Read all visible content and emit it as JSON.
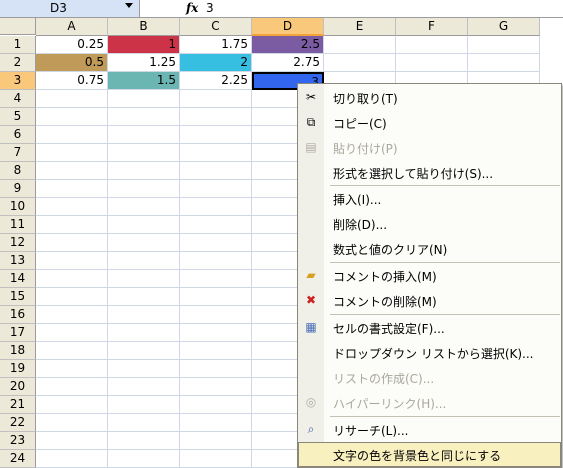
{
  "formula_bar": {
    "name_box": "D3",
    "fx_icon": "fx",
    "formula": "3"
  },
  "columns": [
    "A",
    "B",
    "C",
    "D",
    "E",
    "F",
    "G"
  ],
  "rows": [
    "1",
    "2",
    "3",
    "4",
    "5",
    "6",
    "7",
    "8",
    "9",
    "10",
    "11",
    "12",
    "13",
    "14",
    "15",
    "16",
    "17",
    "18",
    "19",
    "20",
    "21",
    "22",
    "23",
    "24"
  ],
  "cells": {
    "A1": "0.25",
    "B1": "1",
    "C1": "1.75",
    "D1": "2.5",
    "A2": "0.5",
    "B2": "1.25",
    "C2": "2",
    "D2": "2.75",
    "A3": "0.75",
    "B3": "1.5",
    "C3": "2.25",
    "D3": "3"
  },
  "cell_colors": {
    "B1": "#cc3346",
    "D1": "#7b5ca3",
    "A2": "#bf9a58",
    "C2": "#36bfe0",
    "B3": "#6bb6b2",
    "D3": "#3366ee"
  },
  "context_menu": {
    "items": [
      {
        "label": "切り取り(T)",
        "icon": "scissors-icon",
        "disabled": false
      },
      {
        "label": "コピー(C)",
        "icon": "copy-icon",
        "disabled": false
      },
      {
        "label": "貼り付け(P)",
        "icon": "paste-icon",
        "disabled": true
      },
      {
        "label": "形式を選択して貼り付け(S)...",
        "icon": "",
        "disabled": false
      },
      {
        "label": "挿入(I)...",
        "icon": "",
        "disabled": false
      },
      {
        "label": "削除(D)...",
        "icon": "",
        "disabled": false
      },
      {
        "label": "数式と値のクリア(N)",
        "icon": "",
        "disabled": false
      },
      {
        "label": "コメントの挿入(M)",
        "icon": "insert-comment-icon",
        "disabled": false
      },
      {
        "label": "コメントの削除(M)",
        "icon": "delete-comment-icon",
        "disabled": false
      },
      {
        "label": "セルの書式設定(F)...",
        "icon": "format-cells-icon",
        "disabled": false
      },
      {
        "label": "ドロップダウン リストから選択(K)...",
        "icon": "",
        "disabled": false
      },
      {
        "label": "リストの作成(C)...",
        "icon": "",
        "disabled": true
      },
      {
        "label": "ハイパーリンク(H)...",
        "icon": "hyperlink-icon",
        "disabled": true
      },
      {
        "label": "リサーチ(L)...",
        "icon": "research-icon",
        "disabled": false
      },
      {
        "label": "文字の色を背景色と同じにする",
        "icon": "",
        "disabled": false,
        "highlighted": true
      }
    ]
  }
}
